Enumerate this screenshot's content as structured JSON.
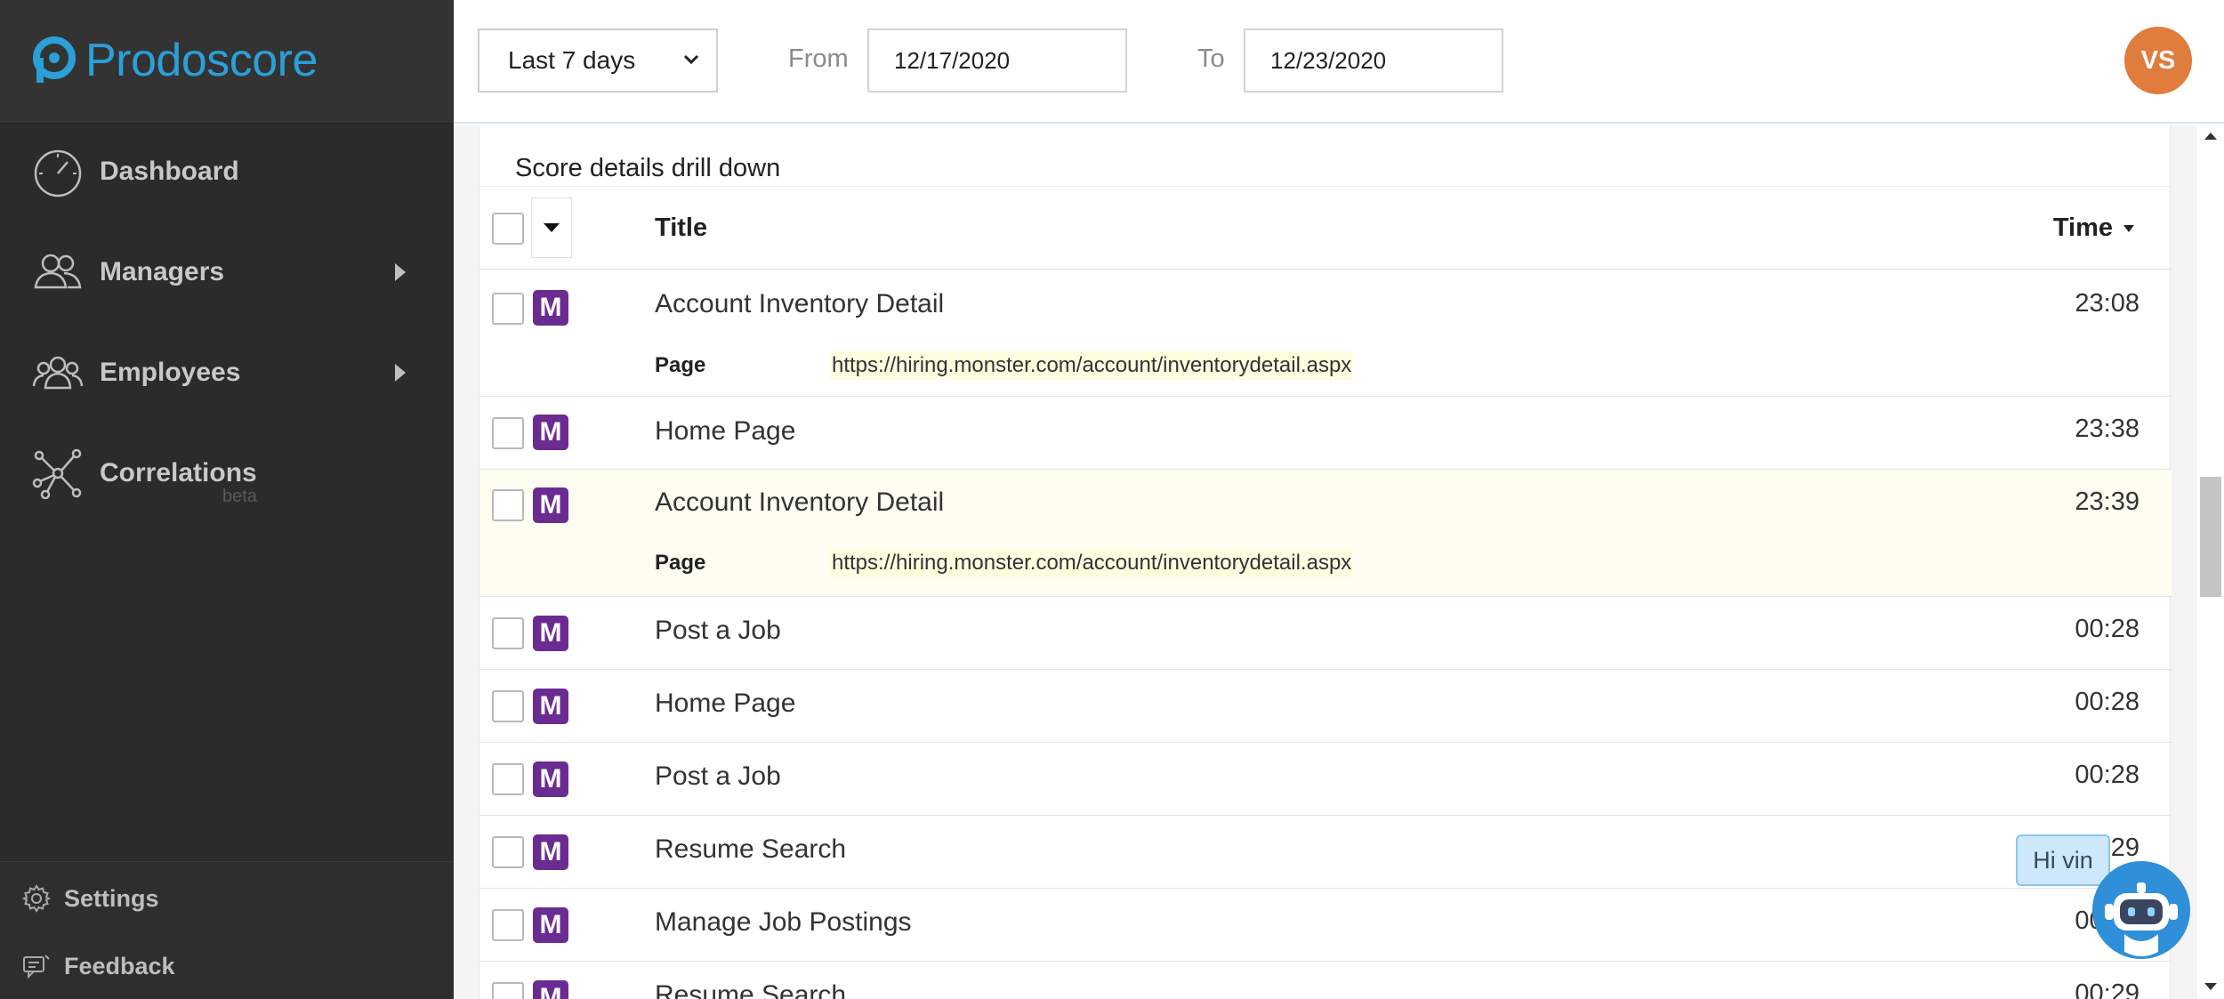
{
  "brand": {
    "name": "Prodoscore"
  },
  "sidebar": {
    "items": [
      {
        "label": "Dashboard",
        "icon": "speedometer-icon"
      },
      {
        "label": "Managers",
        "icon": "managers-icon"
      },
      {
        "label": "Employees",
        "icon": "employees-icon"
      },
      {
        "label": "Correlations",
        "icon": "network-icon",
        "badge": "beta"
      }
    ],
    "footer": [
      {
        "label": "Settings",
        "icon": "gear-icon"
      },
      {
        "label": "Feedback",
        "icon": "feedback-icon"
      }
    ]
  },
  "header": {
    "range": "Last 7 days",
    "from_label": "From",
    "from_value": "12/17/2020",
    "to_label": "To",
    "to_value": "12/23/2020",
    "avatar_initials": "VS"
  },
  "card": {
    "title": "Score details drill down",
    "columns": {
      "title": "Title",
      "time": "Time"
    },
    "page_label": "Page",
    "rows": [
      {
        "title": "Account Inventory Detail",
        "time": "23:08",
        "url": "https://hiring.monster.com/account/inventorydetail.aspx"
      },
      {
        "title": "Home Page",
        "time": "23:38"
      },
      {
        "title": "Account Inventory Detail",
        "time": "23:39",
        "url": "https://hiring.monster.com/account/inventorydetail.aspx"
      },
      {
        "title": "Post a Job",
        "time": "00:28"
      },
      {
        "title": "Home Page",
        "time": "00:28"
      },
      {
        "title": "Post a Job",
        "time": "00:28"
      },
      {
        "title": "Resume Search",
        "time": "00:29"
      },
      {
        "title": "Manage Job Postings",
        "time": "00:29"
      },
      {
        "title": "Resume Search",
        "time": "00:29"
      }
    ],
    "badge_letter": "M"
  },
  "chat": {
    "greeting": "Hi vin"
  },
  "colors": {
    "brand": "#2a9fd8",
    "badge": "#6a2c91",
    "avatar": "#e07c3c",
    "highlight": "#fefdf1"
  }
}
